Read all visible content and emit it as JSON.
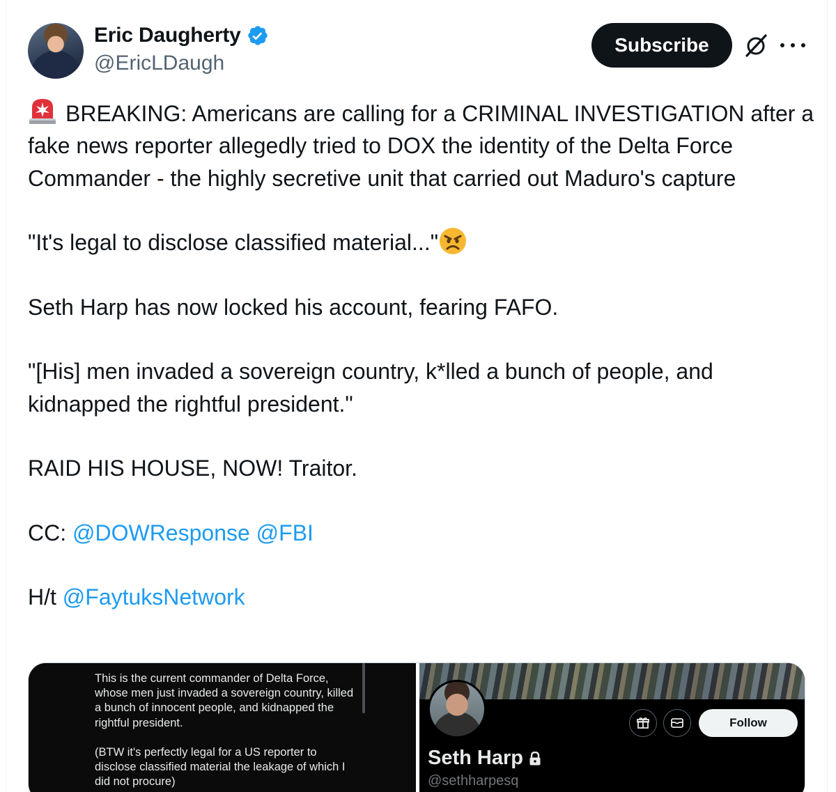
{
  "author": {
    "display_name": "Eric Daugherty",
    "handle": "@EricLDaugh",
    "verified": true
  },
  "actions": {
    "subscribe_label": "Subscribe",
    "grok_icon": "grok-icon",
    "more_icon": "more-options-icon"
  },
  "tweet": {
    "p1_text": "BREAKING: Americans are calling for a CRIMINAL INVESTIGATION after a fake news reporter allegedly tried to DOX the identity of the Delta Force Commander - the highly secretive unit that carried out Maduro's capture",
    "p2_text": "\"It's legal to disclose classified material...\"",
    "p3_text": "Seth Harp has now locked his account, fearing FAFO.",
    "p4_text": "\"[His] men invaded a sovereign country, k*lled a bunch of people, and kidnapped the rightful president.\"",
    "p5_text": "RAID HIS HOUSE, NOW! Traitor.",
    "p6_prefix": "CC: ",
    "p6_mention1": "@DOWResponse",
    "p6_mention2": "@FBI",
    "p7_prefix": "H/t ",
    "p7_mention": "@FaytuksNetwork",
    "emoji_siren": "rotating-light-emoji",
    "emoji_angry": "angry-face-emoji"
  },
  "media": {
    "left_quote_p1": "This is the current commander of Delta Force, whose men just invaded a sovereign country, killed a bunch of innocent people, and kidnapped the rightful president.",
    "left_quote_p2": "(BTW it's perfectly legal for a US reporter to disclose classified material the leakage of which I did not procure)",
    "right_profile": {
      "name": "Seth Harp",
      "handle": "@sethharpesq",
      "follow_label": "Follow",
      "locked": true
    }
  },
  "colors": {
    "link": "#1d9bf0",
    "text": "#0f1419",
    "secondary": "#536471",
    "verified": "#1d9bf0"
  }
}
